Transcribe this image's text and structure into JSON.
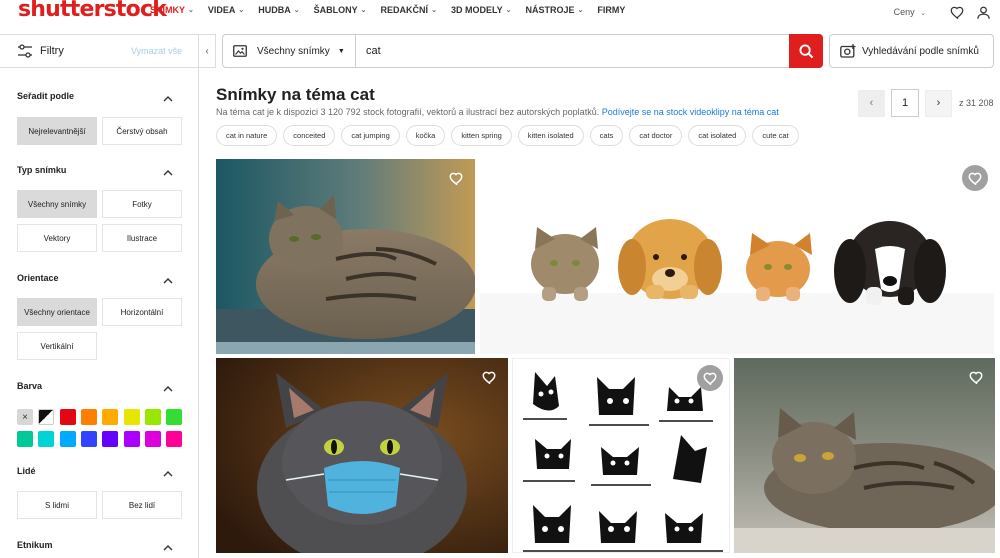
{
  "logo": "shutterstock",
  "nav": {
    "items": [
      {
        "label": "SNÍMKY",
        "active": true,
        "caret": true
      },
      {
        "label": "VIDEA",
        "active": false,
        "caret": true
      },
      {
        "label": "HUDBA",
        "active": false,
        "caret": true
      },
      {
        "label": "ŠABLONY",
        "active": false,
        "caret": true
      },
      {
        "label": "REDAKČNÍ",
        "active": false,
        "caret": true
      },
      {
        "label": "3D MODELY",
        "active": false,
        "caret": true
      },
      {
        "label": "NÁSTROJE",
        "active": false,
        "caret": true
      },
      {
        "label": "FIRMY",
        "active": false,
        "caret": false
      }
    ],
    "price_label": "Ceny",
    "caret_glyph": "⌄"
  },
  "filters": {
    "label": "Filtry",
    "clear": "Vymazat vše"
  },
  "search": {
    "type_label": "Všechny snímky",
    "query": "cat",
    "image_search_label": "Vyhledávání podle snímků"
  },
  "sidebar": {
    "sort": {
      "title": "Seřadit podle",
      "options": [
        "Nejrelevantnější",
        "Čerstvý obsah"
      ],
      "selected": 0
    },
    "type": {
      "title": "Typ snímku",
      "options": [
        "Všechny snímky",
        "Fotky",
        "Vektory",
        "Ilustrace"
      ],
      "selected": 0
    },
    "orientation": {
      "title": "Orientace",
      "options": [
        "Všechny orientace",
        "Horizontální",
        "Vertikální"
      ],
      "selected": 0
    },
    "color": {
      "title": "Barva",
      "swatches": [
        "clear",
        "bw",
        "#e30613",
        "#ff7f00",
        "#ffaa00",
        "#e6e600",
        "#99e600",
        "#33dd33",
        "#00c896",
        "#00d4d4",
        "#00aaff",
        "#3344ff",
        "#6600ff",
        "#aa00ff",
        "#dd00dd",
        "#ff0099"
      ],
      "clear_glyph": "×"
    },
    "people": {
      "title": "Lidé",
      "options": [
        "S lidmi",
        "Bez lidí"
      ]
    },
    "ethnicity": {
      "title": "Etnikum"
    }
  },
  "main": {
    "title": "Snímky na téma cat",
    "subtitle": "Na téma cat je k dispozici 3 120 792 stock fotografií, vektorů a ilustrací bez autorských poplatků.",
    "subtitle_link": "Podívejte se na stock videoklipy na téma cat",
    "page": "1",
    "page_of": "z 31 208",
    "prev_glyph": "‹",
    "next_glyph": "›",
    "tags": [
      "cat in nature",
      "conceited",
      "cat jumping",
      "kočka",
      "kitten spring",
      "kitten isolated",
      "cats",
      "cat doctor",
      "cat isolated",
      "cute cat"
    ]
  },
  "icons": {
    "logo": "shutterstock-logo",
    "heart": "heart-icon",
    "user": "user-icon",
    "filters": "sliders-icon",
    "image": "image-icon",
    "search": "search-icon",
    "camera_search": "image-search-icon",
    "collapse": "chevron-left-icon",
    "section_toggle": "chevron-up-icon",
    "favorite": "heart-icon"
  },
  "colors": {
    "brand_red": "#e01e1e",
    "link_blue": "#1a7ad8"
  }
}
